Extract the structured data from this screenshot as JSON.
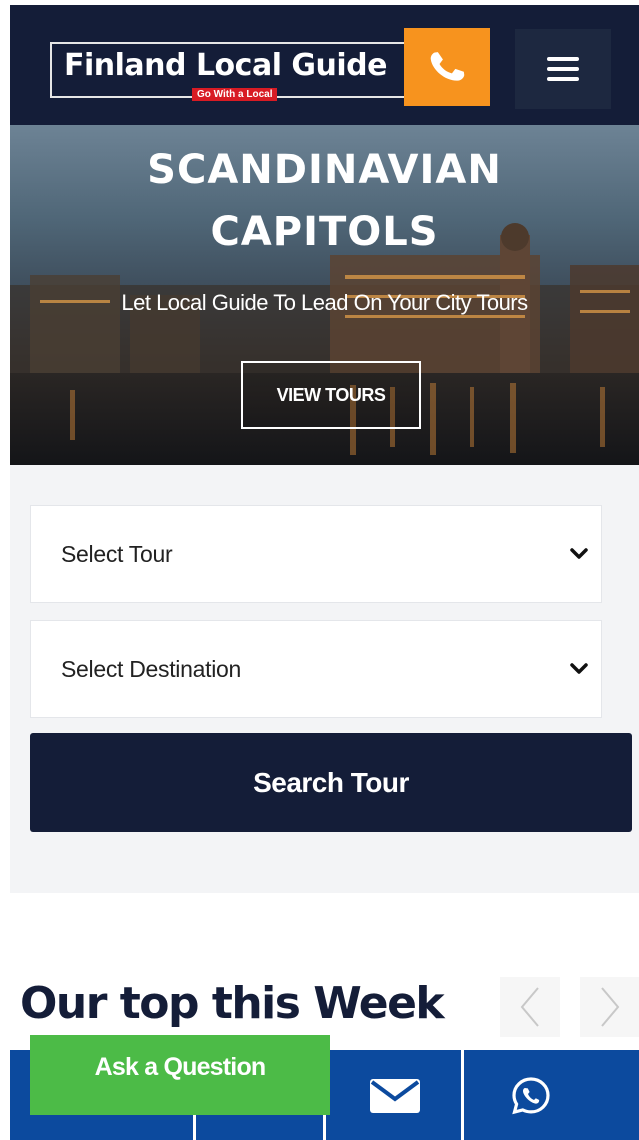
{
  "header": {
    "logo_text": "Finland Local Guide",
    "logo_tagline": "Go With a Local",
    "call_icon": "phone-icon",
    "menu_icon": "hamburger-menu-icon",
    "background_color": "#141d38",
    "call_color": "#f7931e"
  },
  "hero": {
    "title_line1": "SCANDINAVIAN",
    "title_line2": "CAPITOLS",
    "subtitle": "Let Local Guide To Lead On Your City Tours",
    "cta_label": "VIEW TOURS"
  },
  "search": {
    "tour_select": {
      "selected": "Select Tour",
      "icon": "chevron-down-icon"
    },
    "destination_select": {
      "selected": "Select Destination",
      "icon": "chevron-down-icon"
    },
    "submit_label": "Search Tour"
  },
  "section": {
    "title": "Our top this Week",
    "prev_icon": "chevron-left-icon",
    "next_icon": "chevron-right-icon"
  },
  "bottom_bar": {
    "ask_label": "Ask a Question",
    "email_icon": "envelope-icon",
    "whatsapp_icon": "whatsapp-icon",
    "bar_color": "#0c4a9e",
    "ask_color": "#4cbb47"
  }
}
